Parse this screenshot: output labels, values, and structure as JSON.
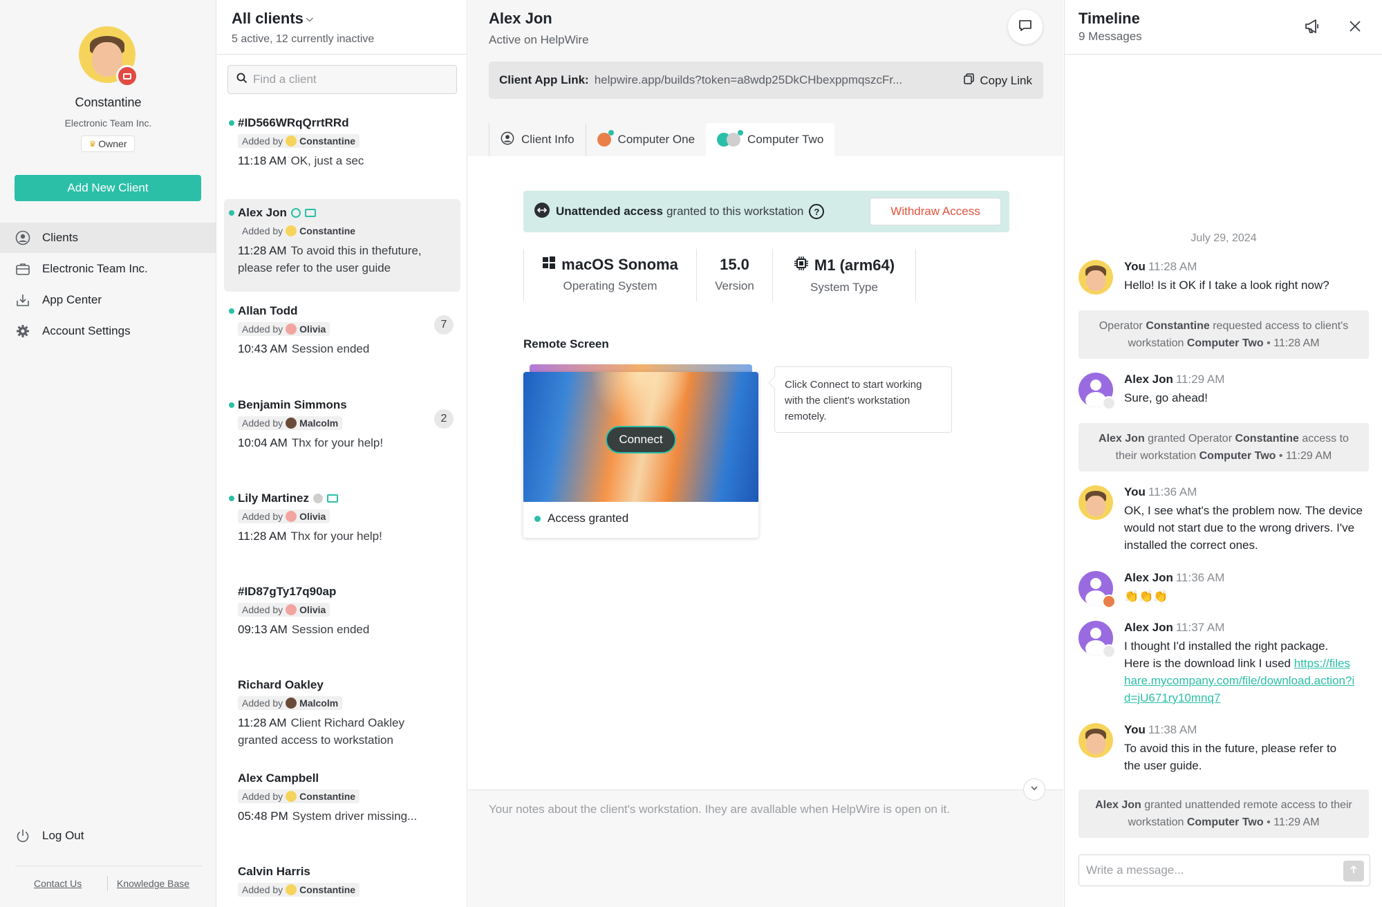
{
  "user": {
    "name": "Constantine",
    "org": "Electronic Team Inc.",
    "role": "Owner"
  },
  "nav": {
    "add_client": "Add New Client",
    "items": [
      {
        "label": "Clients",
        "icon": "user-circle-icon",
        "active": true
      },
      {
        "label": "Electronic Team Inc.",
        "icon": "briefcase-icon",
        "active": false
      },
      {
        "label": "App Center",
        "icon": "download-icon",
        "active": false
      },
      {
        "label": "Account Settings",
        "icon": "gear-icon",
        "active": false
      }
    ],
    "logout": "Log Out",
    "footer": {
      "contact": "Contact Us",
      "kb": "Knowledge Base"
    }
  },
  "clients": {
    "title": "All clients",
    "subtitle": "5 active, 12 currently inactive",
    "search_placeholder": "Find a client",
    "added_by_label": "Added by",
    "list": [
      {
        "name": "#ID566WRqQrrtRRd",
        "online": true,
        "added_by": "Constantine",
        "time": "11:18 AM",
        "message": "OK, just a sec"
      },
      {
        "name": "Alex Jon",
        "online": true,
        "added_by": "Constantine",
        "time": "11:28 AM",
        "message": "To avoid this in thefuture, please refer to the user guide",
        "active": true
      },
      {
        "name": "Allan Todd",
        "online": true,
        "added_by": "Olivia",
        "time": "10:43 AM",
        "message": "Session ended",
        "unread": "7"
      },
      {
        "name": "Benjamin Simmons",
        "online": true,
        "added_by": "Malcolm",
        "time": "10:04 AM",
        "message": "Thx for your help!",
        "unread": "2"
      },
      {
        "name": "Lily Martinez",
        "online": true,
        "added_by": "Olivia",
        "time": "11:28 AM",
        "message": "Thx for your help!"
      },
      {
        "name": "#ID87gTy17q90ap",
        "online": false,
        "added_by": "Olivia",
        "time": "09:13 AM",
        "message": "Session ended"
      },
      {
        "name": "Richard Oakley",
        "online": false,
        "added_by": "Malcolm",
        "time": "11:28 AM",
        "message": "Client Richard Oakley granted access to workstation"
      },
      {
        "name": "Alex Campbell",
        "online": false,
        "added_by": "Constantine",
        "time": "05:48 PM",
        "message": "System driver missing..."
      },
      {
        "name": "Calvin Harris",
        "online": false,
        "added_by": "Constantine",
        "time": "",
        "message": ""
      }
    ]
  },
  "main": {
    "client_name": "Alex Jon",
    "status": "Active on HelpWire",
    "link_label": "Client App Link:",
    "link_value": "helpwire.app/builds?token=a8wdp25DkCHbexppmqszcFr...",
    "copy_label": "Copy Link",
    "tabs": [
      {
        "label": "Client Info",
        "active": false
      },
      {
        "label": "Computer One",
        "active": false
      },
      {
        "label": "Computer Two",
        "active": true
      }
    ],
    "unattended": {
      "bold": "Unattended access",
      "rest": "granted to this workstation",
      "withdraw": "Withdraw Access"
    },
    "specs": [
      {
        "value": "macOS Sonoma",
        "label": "Operating System",
        "icon": "windows-icon"
      },
      {
        "value": "15.0",
        "label": "Version",
        "icon": ""
      },
      {
        "value": "M1 (arm64)",
        "label": "System Type",
        "icon": "chip-icon"
      }
    ],
    "remote_title": "Remote Screen",
    "connect": "Connect",
    "access_status": "Access granted",
    "tooltip": "Click Connect to start working with the client's workstation remotely.",
    "notes_placeholder": "Your notes about the client's workstation. Ihey are avallable when HelpWire is open on it."
  },
  "timeline": {
    "title": "Timeline",
    "subtitle": "9 Messages",
    "date": "July 29, 2024",
    "messages": [
      {
        "who": "You",
        "time": "11:28 AM",
        "text": "Hello! Is it OK if I take a look right now?"
      },
      {
        "sys": [
          "Operator ",
          "Constantine",
          " requested access to client's workstation ",
          "Computer Two",
          " • 11:28 AM"
        ]
      },
      {
        "who": "Alex Jon",
        "time": "11:29 AM",
        "text": "Sure, go ahead!"
      },
      {
        "sys": [
          "",
          "Alex Jon",
          " granted Operator ",
          "Constantine",
          " access to their workstation ",
          "Computer Two",
          " • 11:29 AM"
        ]
      },
      {
        "who": "You",
        "time": "11:36 AM",
        "text": "OK, I see what's the problem now. The device would not start due to the wrong drivers. I've installed the correct ones."
      },
      {
        "who": "Alex Jon",
        "time": "11:36 AM",
        "text": "👏👏👏"
      },
      {
        "who": "Alex Jon",
        "time": "11:37 AM",
        "text": "I thought I'd installed the right package. Here is the download link I used ",
        "link": "https://fileshare.mycompany.com/file/download.action?id=jU671ry10mnq7"
      },
      {
        "who": "You",
        "time": "11:38 AM",
        "text": "To avoid this in the future, please refer to the user guide."
      },
      {
        "sys": [
          "",
          "Alex Jon",
          " granted unattended remote access to their workstation ",
          "Computer Two",
          " • 11:29 AM"
        ]
      }
    ],
    "composer_placeholder": "Write a message..."
  },
  "colors": {
    "accent": "#2bbfa8",
    "danger": "#e0533e",
    "unattended_bg": "#d3ece8"
  }
}
